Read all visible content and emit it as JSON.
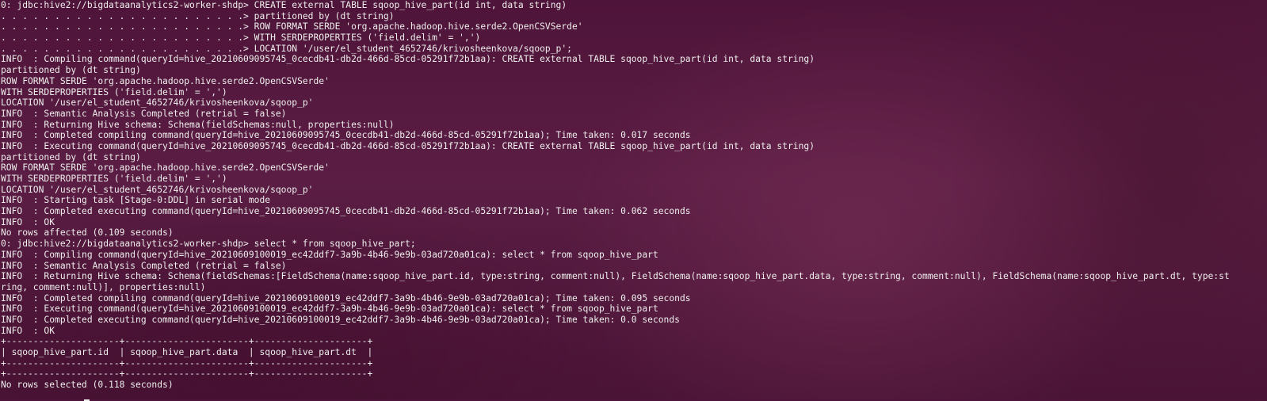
{
  "terminal": {
    "lines": [
      "0: jdbc:hive2://bigdataanalytics2-worker-shdp> CREATE external TABLE sqoop_hive_part(id int, data string)",
      ". . . . . . . . . . . . . . . . . . . . . . .> partitioned by (dt string)",
      ". . . . . . . . . . . . . . . . . . . . . . .> ROW FORMAT SERDE 'org.apache.hadoop.hive.serde2.OpenCSVSerde'",
      ". . . . . . . . . . . . . . . . . . . . . . .> WITH SERDEPROPERTIES ('field.delim' = ',')",
      ". . . . . . . . . . . . . . . . . . . . . . .> LOCATION '/user/el_student_4652746/krivosheenkova/sqoop_p';",
      "INFO  : Compiling command(queryId=hive_20210609095745_0cecdb41-db2d-466d-85cd-05291f72b1aa): CREATE external TABLE sqoop_hive_part(id int, data string)",
      "partitioned by (dt string)",
      "ROW FORMAT SERDE 'org.apache.hadoop.hive.serde2.OpenCSVSerde'",
      "WITH SERDEPROPERTIES ('field.delim' = ',')",
      "LOCATION '/user/el_student_4652746/krivosheenkova/sqoop_p'",
      "INFO  : Semantic Analysis Completed (retrial = false)",
      "INFO  : Returning Hive schema: Schema(fieldSchemas:null, properties:null)",
      "INFO  : Completed compiling command(queryId=hive_20210609095745_0cecdb41-db2d-466d-85cd-05291f72b1aa); Time taken: 0.017 seconds",
      "INFO  : Executing command(queryId=hive_20210609095745_0cecdb41-db2d-466d-85cd-05291f72b1aa): CREATE external TABLE sqoop_hive_part(id int, data string)",
      "partitioned by (dt string)",
      "ROW FORMAT SERDE 'org.apache.hadoop.hive.serde2.OpenCSVSerde'",
      "WITH SERDEPROPERTIES ('field.delim' = ',')",
      "LOCATION '/user/el_student_4652746/krivosheenkova/sqoop_p'",
      "INFO  : Starting task [Stage-0:DDL] in serial mode",
      "INFO  : Completed executing command(queryId=hive_20210609095745_0cecdb41-db2d-466d-85cd-05291f72b1aa); Time taken: 0.062 seconds",
      "INFO  : OK",
      "No rows affected (0.109 seconds)",
      "0: jdbc:hive2://bigdataanalytics2-worker-shdp> select * from sqoop_hive_part;",
      "INFO  : Compiling command(queryId=hive_20210609100019_ec42ddf7-3a9b-4b46-9e9b-03ad720a01ca): select * from sqoop_hive_part",
      "INFO  : Semantic Analysis Completed (retrial = false)",
      "INFO  : Returning Hive schema: Schema(fieldSchemas:[FieldSchema(name:sqoop_hive_part.id, type:string, comment:null), FieldSchema(name:sqoop_hive_part.data, type:string, comment:null), FieldSchema(name:sqoop_hive_part.dt, type:st",
      "ring, comment:null)], properties:null)",
      "INFO  : Completed compiling command(queryId=hive_20210609100019_ec42ddf7-3a9b-4b46-9e9b-03ad720a01ca); Time taken: 0.095 seconds",
      "INFO  : Executing command(queryId=hive_20210609100019_ec42ddf7-3a9b-4b46-9e9b-03ad720a01ca): select * from sqoop_hive_part",
      "INFO  : Completed executing command(queryId=hive_20210609100019_ec42ddf7-3a9b-4b46-9e9b-03ad720a01ca); Time taken: 0.0 seconds",
      "INFO  : OK",
      "+---------------------+-----------------------+---------------------+",
      "| sqoop_hive_part.id  | sqoop_hive_part.data  | sqoop_hive_part.dt  |",
      "+---------------------+-----------------------+---------------------+",
      "+---------------------+-----------------------+---------------------+",
      "No rows selected (0.118 seconds)"
    ]
  }
}
